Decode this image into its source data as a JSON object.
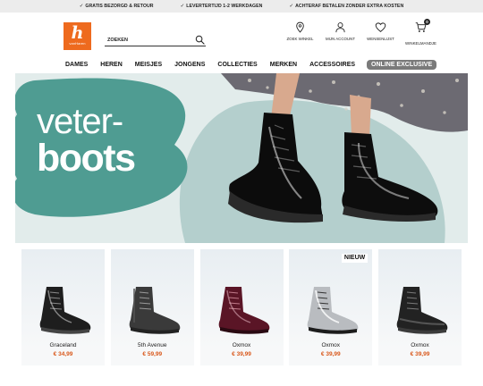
{
  "usp_bar": {
    "items": [
      "GRATIS BEZORGD & RETOUR",
      "LEVERTERTIJD 1-2 WERKDAGEN",
      "ACHTERAF BETALEN ZONDER EXTRA KOSTEN"
    ],
    "check_icon": "✓"
  },
  "header": {
    "logo": {
      "mark": "h",
      "word": "vanHaren",
      "color": "#ee6a1e"
    },
    "search": {
      "placeholder": "ZOEKEN"
    },
    "links": [
      {
        "label": "ZOEK WINKEL",
        "icon": "location-pin-icon"
      },
      {
        "label": "MIJN ACCOUNT",
        "icon": "user-icon"
      },
      {
        "label": "WENSENLIJST",
        "icon": "heart-icon"
      },
      {
        "label": "WINKELMANDJE",
        "icon": "shopping-cart-icon",
        "badge": "0"
      }
    ]
  },
  "nav": {
    "items": [
      "DAMES",
      "HEREN",
      "MEISJES",
      "JONGENS",
      "COLLECTIES",
      "MERKEN",
      "ACCESSOIRES"
    ],
    "exclusive": "ONLINE EXCLUSIVE"
  },
  "hero": {
    "headline_1": "veter-",
    "headline_2": "boots",
    "accent_color": "#4f9c92"
  },
  "products": [
    {
      "name": "Graceland",
      "price": "€ 34,99",
      "color": "#1e1e1e",
      "badge": ""
    },
    {
      "name": "5th Avenue",
      "price": "€ 59,99",
      "color": "#3a3a3a",
      "badge": ""
    },
    {
      "name": "Oxmox",
      "price": "€ 39,99",
      "color": "#5a1526",
      "badge": ""
    },
    {
      "name": "Oxmox",
      "price": "€ 39,99",
      "color": "#b9bcc0",
      "badge": "NIEUW"
    },
    {
      "name": "Oxmox",
      "price": "€ 39,99",
      "color": "#222222",
      "badge": ""
    }
  ],
  "colors": {
    "price": "#d9581b",
    "nav_exclusive_bg": "#7a7a7a",
    "hero_bg": "#e2eceb"
  }
}
